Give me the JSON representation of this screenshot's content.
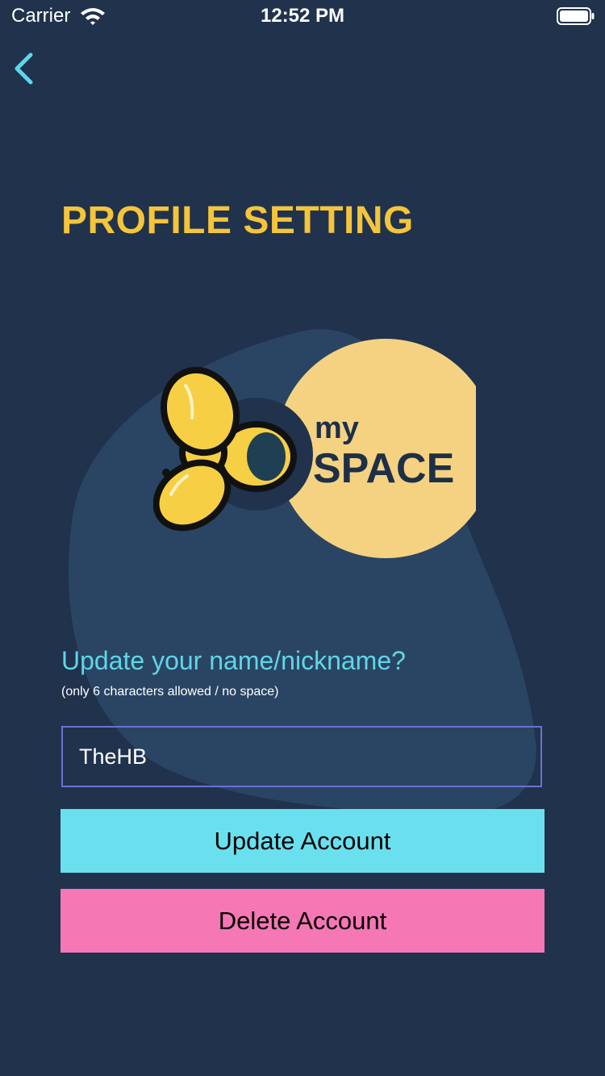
{
  "status_bar": {
    "carrier": "Carrier",
    "time": "12:52 PM",
    "wifi_icon": "wifi-icon",
    "battery_icon": "battery-icon"
  },
  "nav": {
    "back_icon": "chevron-left-icon"
  },
  "page": {
    "title": "PROFILE SETTING"
  },
  "logo": {
    "line1": "my",
    "line2": "SPACE"
  },
  "form": {
    "prompt": "Update your name/nickname?",
    "hint": "(only 6 characters allowed / no space)",
    "name_value": "TheHB"
  },
  "buttons": {
    "update_label": "Update Account",
    "delete_label": "Delete Account"
  },
  "colors": {
    "background": "#20324c",
    "title": "#f4c43b",
    "accent_cyan": "#5fd6e8",
    "update_button": "#6ae0ee",
    "delete_button": "#f577b4",
    "field_border": "#6c70d6"
  }
}
